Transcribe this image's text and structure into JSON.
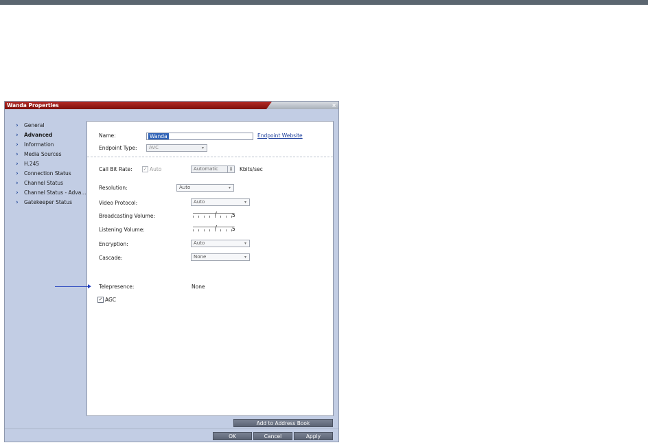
{
  "dialog": {
    "title": "Wanda  Properties",
    "close_glyph": "×"
  },
  "sidebar": {
    "items": [
      {
        "label": "General"
      },
      {
        "label": "Advanced",
        "active": true
      },
      {
        "label": "Information"
      },
      {
        "label": "Media Sources"
      },
      {
        "label": "H.245"
      },
      {
        "label": "Connection Status"
      },
      {
        "label": "Channel Status"
      },
      {
        "label": "Channel Status - Adva..."
      },
      {
        "label": "Gatekeeper Status"
      }
    ]
  },
  "form": {
    "name_label": "Name:",
    "name_value": "Wanda",
    "endpoint_website_link": "Endpoint Website",
    "endpoint_type_label": "Endpoint Type:",
    "endpoint_type_value": "AVC",
    "call_bit_rate_label": "Call Bit Rate:",
    "auto_checkbox_label": "Auto",
    "auto_checked": true,
    "bit_rate_value": "Automatic",
    "bit_rate_unit": "Kbits/sec",
    "resolution_label": "Resolution:",
    "resolution_value": "Auto",
    "video_protocol_label": "Video Protocol:",
    "video_protocol_value": "Auto",
    "broadcasting_volume_label": "Broadcasting Volume:",
    "broadcasting_volume_value": "5",
    "listening_volume_label": "Listening Volume:",
    "listening_volume_value": "5",
    "encryption_label": "Encryption:",
    "encryption_value": "Auto",
    "cascade_label": "Cascade:",
    "cascade_value": "None",
    "telepresence_label": "Telepresence:",
    "telepresence_value": "None",
    "agc_label": "AGC",
    "agc_checked": true
  },
  "buttons": {
    "add_to_address_book": "Add to Address Book",
    "ok": "OK",
    "cancel": "Cancel",
    "apply": "Apply"
  },
  "icons": {
    "nav_arrow": "›",
    "checkmark": "✓",
    "combo_arrow": "▾"
  },
  "colors": {
    "title_bar": "#9a1a16",
    "accent_blue": "#2e62b7",
    "dialog_bg": "#c2cde4",
    "button_bg": "#6b7384"
  }
}
